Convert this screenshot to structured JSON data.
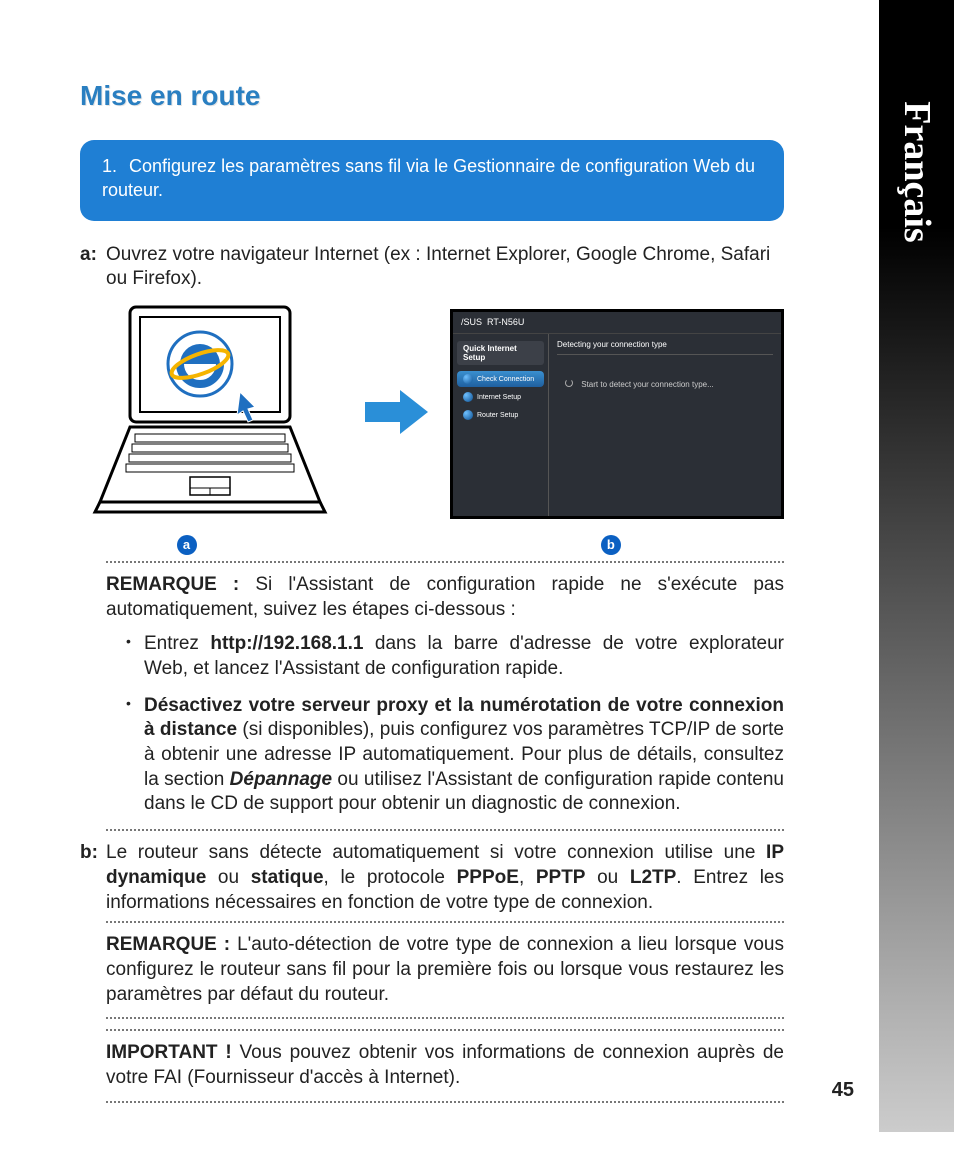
{
  "language_tab": "Français",
  "title": "Mise en route",
  "blue_box": {
    "num": "1.",
    "text": "Configurez les paramètres sans fil via le Gestionnaire de configuration Web du routeur."
  },
  "step_a": {
    "label": "a:",
    "text": "Ouvrez votre navigateur Internet (ex : Internet Explorer, Google Chrome, Safari ou Firefox)."
  },
  "router_screenshot": {
    "brand": "/SUS",
    "model": "RT-N56U",
    "sidebar_title": "Quick Internet Setup",
    "items": {
      "check": "Check Connection",
      "internet": "Internet Setup",
      "router": "Router Setup"
    },
    "main_header": "Detecting your connection type",
    "main_status": "Start to detect your connection type..."
  },
  "fig_labels": {
    "a": "a",
    "b": "b"
  },
  "note1": {
    "label": "REMARQUE :",
    "text": " Si l'Assistant de configuration rapide ne s'exécute pas automatiquement, suivez les étapes ci-dessous :"
  },
  "bullet1": {
    "pre": "Entrez ",
    "url": "http://192.168.1.1",
    "post": " dans la barre d'adresse de votre explorateur Web, et lancez l'Assistant de configuration rapide."
  },
  "bullet2": {
    "bold": "Désactivez votre serveur proxy et la numérotation de votre connexion à distance",
    "mid": " (si disponibles), puis configurez vos paramètres TCP/IP de sorte à obtenir une adresse IP automatiquement. Pour plus de détails, consultez la section ",
    "ref": "Dépannage",
    "post": " ou utilisez l'Assistant de configuration rapide contenu dans le CD de support pour obtenir un diagnostic de connexion."
  },
  "step_b": {
    "label": "b:",
    "pre": "Le routeur sans détecte automatiquement si votre connexion utilise une ",
    "b1": "IP dynamique",
    "t1": " ou ",
    "b2": "statique",
    "t2": ", le protocole ",
    "b3": "PPPoE",
    "t3": ", ",
    "b4": "PPTP",
    "t4": " ou ",
    "b5": "L2TP",
    "post": ". Entrez les informations nécessaires en fonction de votre type de connexion."
  },
  "note2": {
    "label": "REMARQUE :",
    "text": " L'auto-détection de votre type de connexion a lieu lorsque vous configurez le routeur sans fil pour la première fois ou lorsque vous restaurez les paramètres par défaut du routeur."
  },
  "note3": {
    "label": "IMPORTANT !",
    "text": " Vous pouvez obtenir vos informations de connexion auprès de votre FAI (Fournisseur d'accès à Internet)."
  },
  "page_number": "45"
}
